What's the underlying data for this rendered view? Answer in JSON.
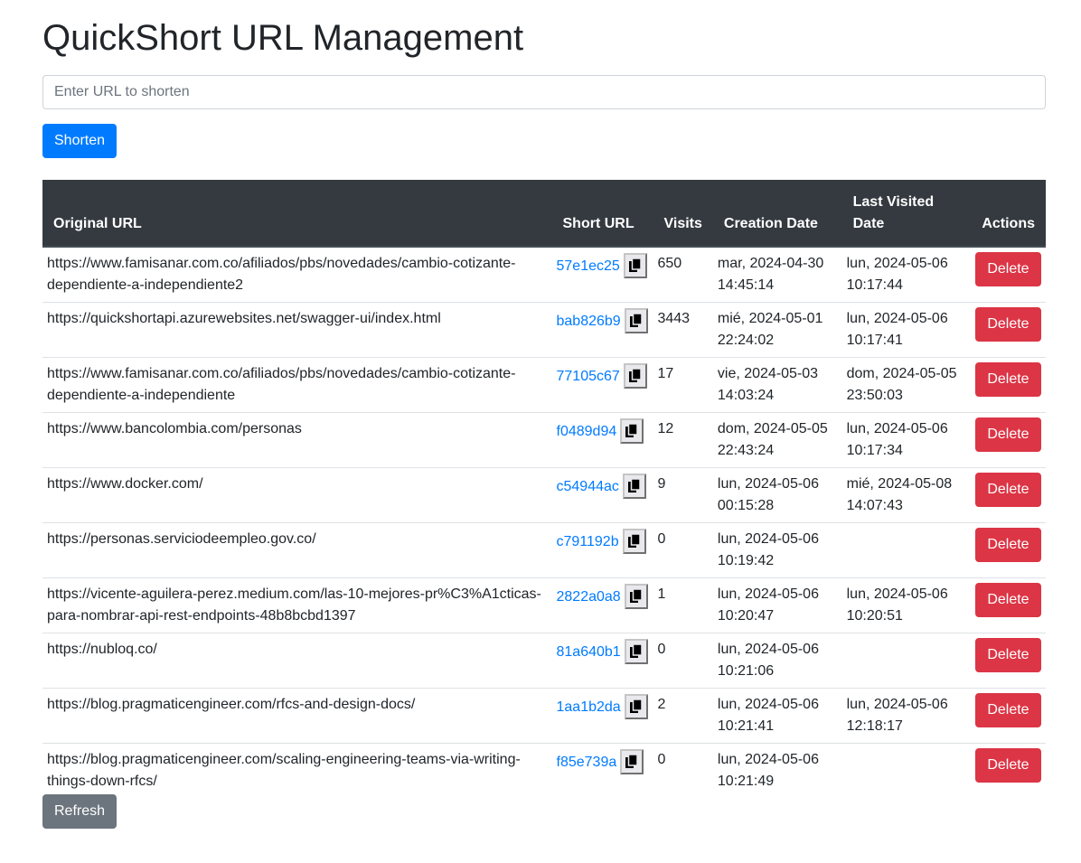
{
  "page": {
    "title": "QuickShort URL Management",
    "input_placeholder": "Enter URL to shorten",
    "shorten_label": "Shorten",
    "refresh_label": "Refresh"
  },
  "table": {
    "headers": {
      "original": "Original URL",
      "short": "Short URL",
      "visits": "Visits",
      "created": "Creation Date",
      "last_visited": "Last Visited Date",
      "actions": "Actions"
    },
    "delete_label": "Delete",
    "rows": [
      {
        "original": "https://www.famisanar.com.co/afiliados/pbs/novedades/cambio-cotizante-dependiente-a-independiente2",
        "short": "57e1ec25",
        "visits": "650",
        "created": "mar, 2024-04-30 14:45:14",
        "last_visited": "lun, 2024-05-06 10:17:44"
      },
      {
        "original": "https://quickshortapi.azurewebsites.net/swagger-ui/index.html",
        "short": "bab826b9",
        "visits": "3443",
        "created": "mié, 2024-05-01 22:24:02",
        "last_visited": "lun, 2024-05-06 10:17:41"
      },
      {
        "original": "https://www.famisanar.com.co/afiliados/pbs/novedades/cambio-cotizante-dependiente-a-independiente",
        "short": "77105c67",
        "visits": "17",
        "created": "vie, 2024-05-03 14:03:24",
        "last_visited": "dom, 2024-05-05 23:50:03"
      },
      {
        "original": "https://www.bancolombia.com/personas",
        "short": "f0489d94",
        "visits": "12",
        "created": "dom, 2024-05-05 22:43:24",
        "last_visited": "lun, 2024-05-06 10:17:34"
      },
      {
        "original": "https://www.docker.com/",
        "short": "c54944ac",
        "visits": "9",
        "created": "lun, 2024-05-06 00:15:28",
        "last_visited": "mié, 2024-05-08 14:07:43"
      },
      {
        "original": "https://personas.serviciodeempleo.gov.co/",
        "short": "c791192b",
        "visits": "0",
        "created": "lun, 2024-05-06 10:19:42",
        "last_visited": ""
      },
      {
        "original": "https://vicente-aguilera-perez.medium.com/las-10-mejores-pr%C3%A1cticas-para-nombrar-api-rest-endpoints-48b8bcbd1397",
        "short": "2822a0a8",
        "visits": "1",
        "created": "lun, 2024-05-06 10:20:47",
        "last_visited": "lun, 2024-05-06 10:20:51"
      },
      {
        "original": "https://nubloq.co/",
        "short": "81a640b1",
        "visits": "0",
        "created": "lun, 2024-05-06 10:21:06",
        "last_visited": ""
      },
      {
        "original": "https://blog.pragmaticengineer.com/rfcs-and-design-docs/",
        "short": "1aa1b2da",
        "visits": "2",
        "created": "lun, 2024-05-06 10:21:41",
        "last_visited": "lun, 2024-05-06 12:18:17"
      },
      {
        "original": "https://blog.pragmaticengineer.com/scaling-engineering-teams-via-writing-things-down-rfcs/",
        "short": "f85e739a",
        "visits": "0",
        "created": "lun, 2024-05-06 10:21:49",
        "last_visited": ""
      }
    ]
  },
  "colors": {
    "primary": "#007bff",
    "danger": "#dc3545",
    "secondary": "#6c757d",
    "header_bg": "#343a40"
  },
  "icons": {
    "copy": "copy-icon"
  }
}
